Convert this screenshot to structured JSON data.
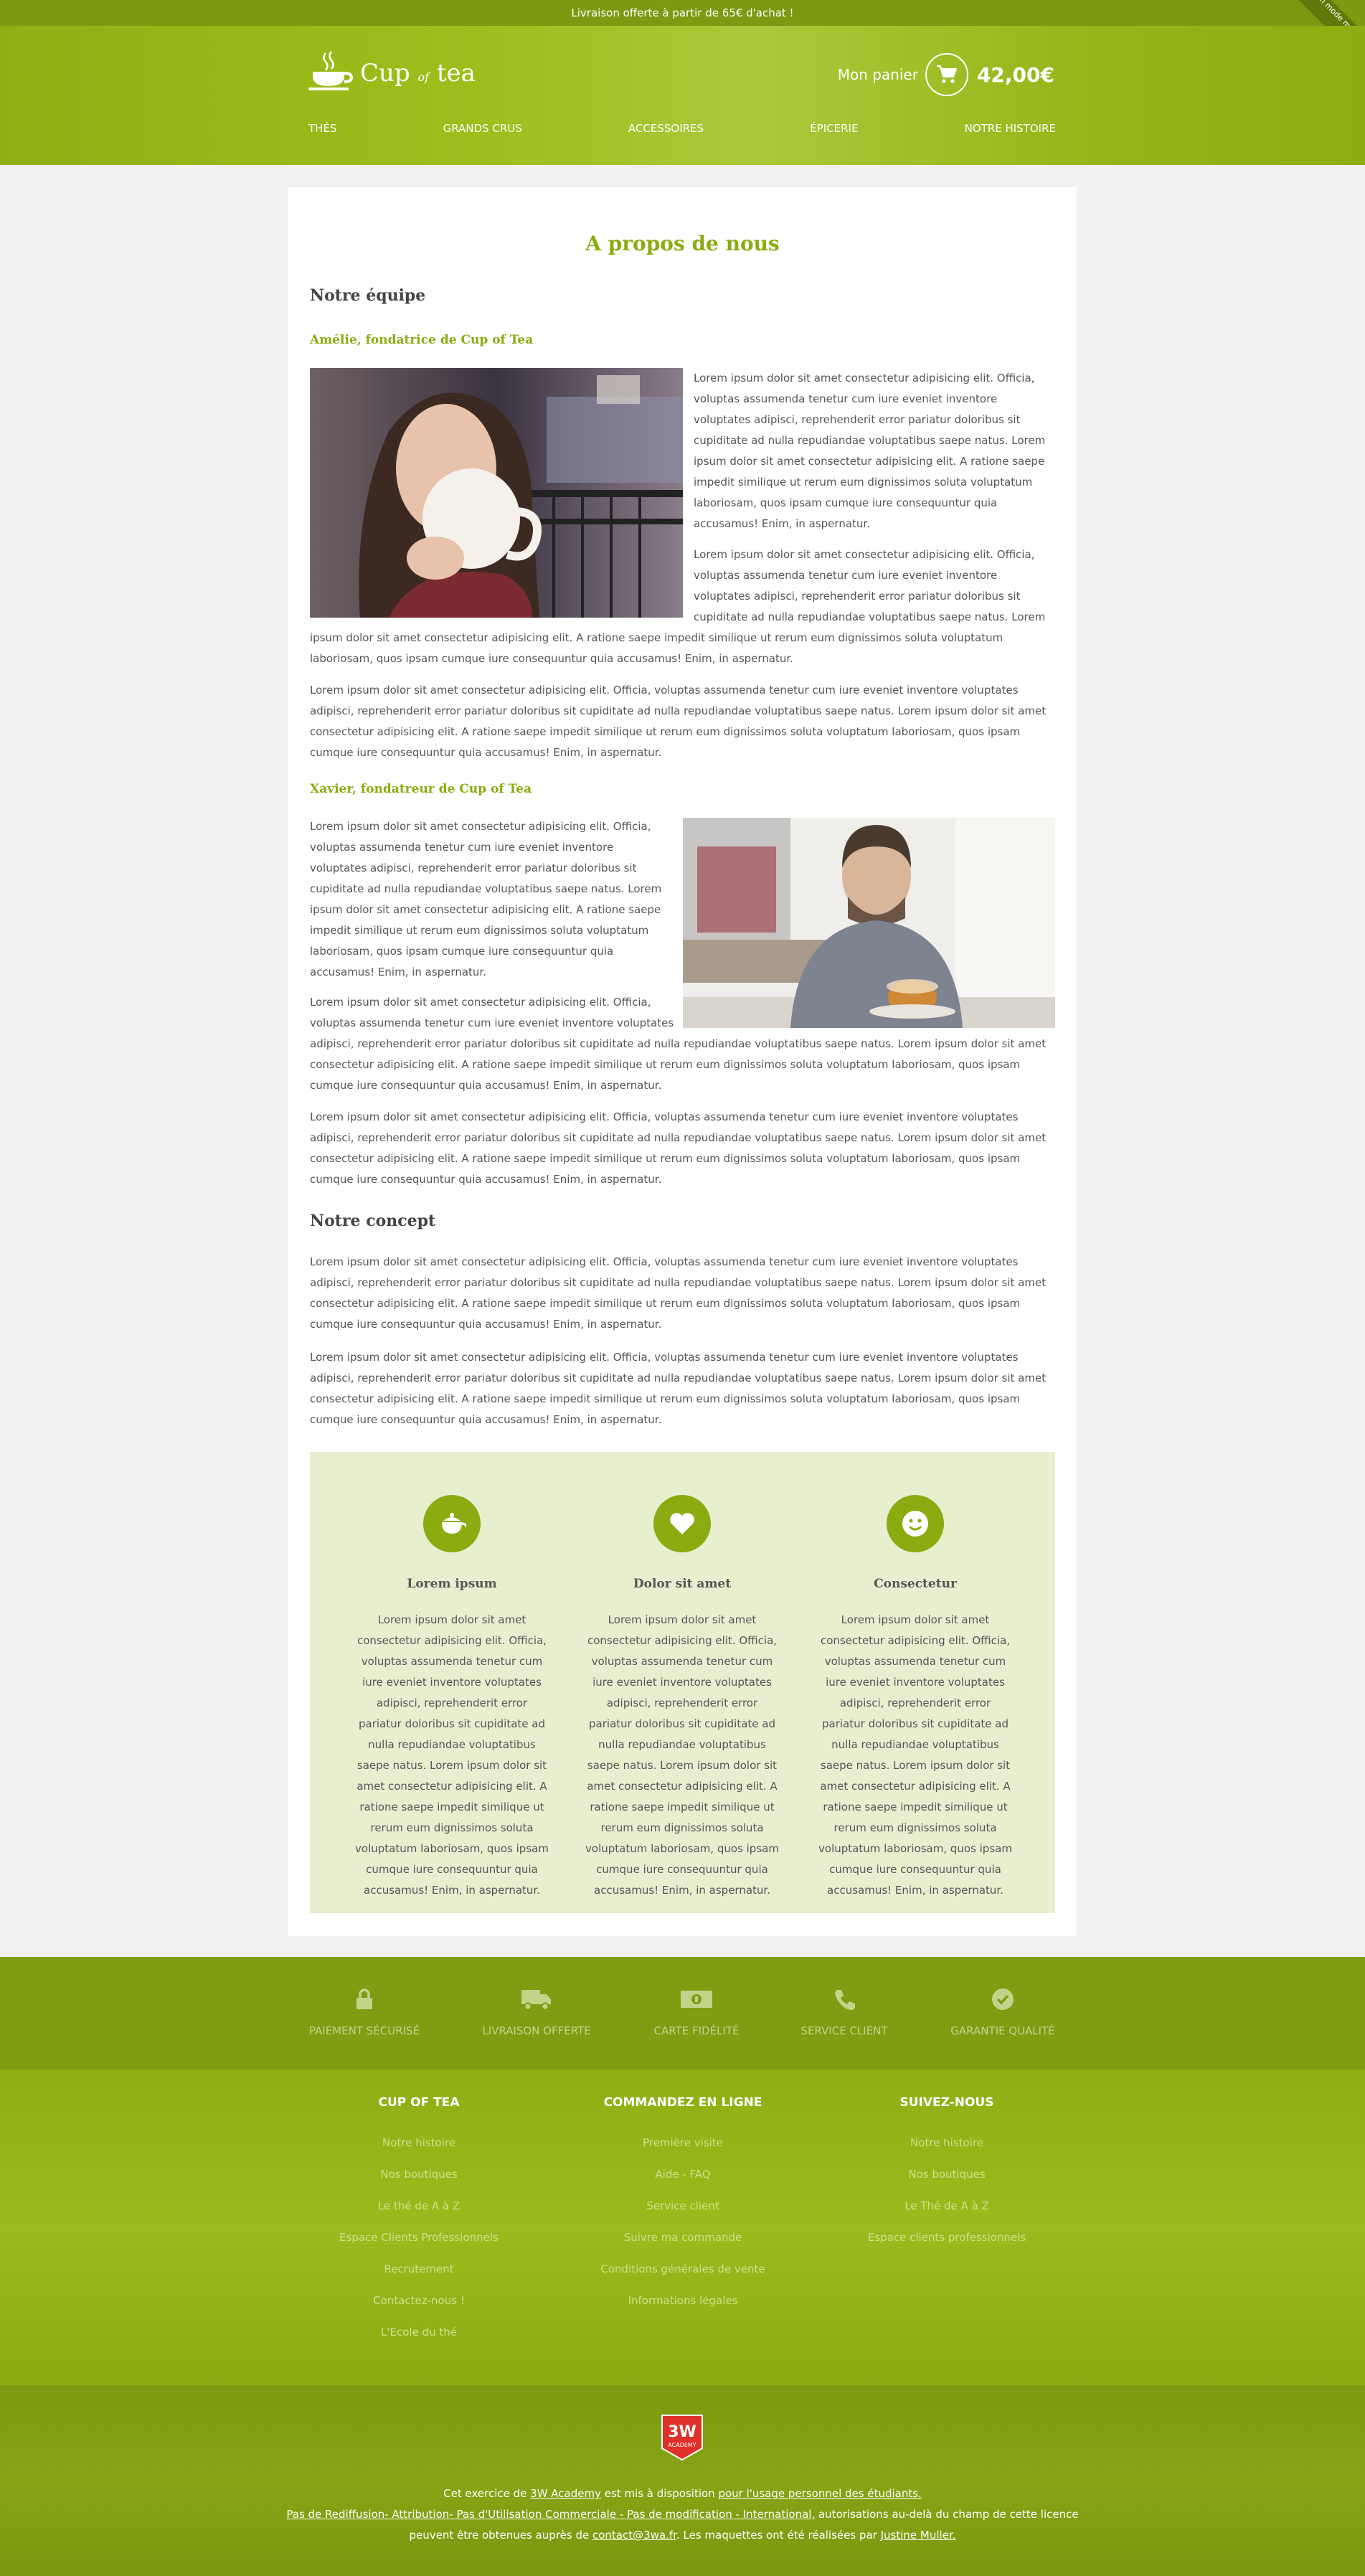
{
  "topbar": {
    "text": "Livraison offerte à partir de 65€ d'achat !",
    "ribbon": "En mode mobile"
  },
  "header": {
    "logo_main": "Cup",
    "logo_of": "of",
    "logo_tea": "tea",
    "cart_label": "Mon panier",
    "cart_total": "42,00€"
  },
  "nav": [
    "THÉS",
    "GRANDS CRUS",
    "ACCESSOIRES",
    "ÉPICERIE",
    "NOTRE HISTOIRE"
  ],
  "page": {
    "title": "A propos de nous",
    "team_heading": "Notre équipe",
    "person1": {
      "name": "Amélie, fondatrice de Cup of Tea",
      "p1": "Lorem ipsum dolor sit amet consectetur adipisicing elit. Officia, voluptas assumenda tenetur cum iure eveniet inventore voluptates adipisci, reprehenderit error pariatur doloribus sit cupiditate ad nulla repudiandae voluptatibus saepe natus. Lorem ipsum dolor sit amet consectetur adipisicing elit. A ratione saepe impedit similique ut rerum eum dignissimos soluta voluptatum laboriosam, quos ipsam cumque iure consequuntur quia accusamus! Enim, in aspernatur.",
      "p2": "Lorem ipsum dolor sit amet consectetur adipisicing elit. Officia, voluptas assumenda tenetur cum iure eveniet inventore voluptates adipisci, reprehenderit error pariatur doloribus sit cupiditate ad nulla repudiandae voluptatibus saepe natus. Lorem ipsum dolor sit amet consectetur adipisicing elit. A ratione saepe impedit similique ut rerum eum dignissimos soluta voluptatum laboriosam, quos ipsam cumque iure consequuntur quia accusamus! Enim, in aspernatur.",
      "p3": "Lorem ipsum dolor sit amet consectetur adipisicing elit. Officia, voluptas assumenda tenetur cum iure eveniet inventore voluptates adipisci, reprehenderit error pariatur doloribus sit cupiditate ad nulla repudiandae voluptatibus saepe natus. Lorem ipsum dolor sit amet consectetur adipisicing elit. A ratione saepe impedit similique ut rerum eum dignissimos soluta voluptatum laboriosam, quos ipsam cumque iure consequuntur quia accusamus! Enim, in aspernatur."
    },
    "person2": {
      "name": "Xavier, fondatreur de Cup of Tea",
      "p1": "Lorem ipsum dolor sit amet consectetur adipisicing elit. Officia, voluptas assumenda tenetur cum iure eveniet inventore voluptates adipisci, reprehenderit error pariatur doloribus sit cupiditate ad nulla repudiandae voluptatibus saepe natus. Lorem ipsum dolor sit amet consectetur adipisicing elit. A ratione saepe impedit similique ut rerum eum dignissimos soluta voluptatum laboriosam, quos ipsam cumque iure consequuntur quia accusamus! Enim, in aspernatur.",
      "p2": "Lorem ipsum dolor sit amet consectetur adipisicing elit. Officia, voluptas assumenda tenetur cum iure eveniet inventore voluptates adipisci, reprehenderit error pariatur doloribus sit cupiditate ad nulla repudiandae voluptatibus saepe natus. Lorem ipsum dolor sit amet consectetur adipisicing elit. A ratione saepe impedit similique ut rerum eum dignissimos soluta voluptatum laboriosam, quos ipsam cumque iure consequuntur quia accusamus! Enim, in aspernatur.",
      "p3": "Lorem ipsum dolor sit amet consectetur adipisicing elit. Officia, voluptas assumenda tenetur cum iure eveniet inventore voluptates adipisci, reprehenderit error pariatur doloribus sit cupiditate ad nulla repudiandae voluptatibus saepe natus. Lorem ipsum dolor sit amet consectetur adipisicing elit. A ratione saepe impedit similique ut rerum eum dignissimos soluta voluptatum laboriosam, quos ipsam cumque iure consequuntur quia accusamus! Enim, in aspernatur."
    },
    "concept_heading": "Notre concept",
    "concept_p1": "Lorem ipsum dolor sit amet consectetur adipisicing elit. Officia, voluptas assumenda tenetur cum iure eveniet inventore voluptates adipisci, reprehenderit error pariatur doloribus sit cupiditate ad nulla repudiandae voluptatibus saepe natus. Lorem ipsum dolor sit amet consectetur adipisicing elit. A ratione saepe impedit similique ut rerum eum dignissimos soluta voluptatum laboriosam, quos ipsam cumque iure consequuntur quia accusamus! Enim, in aspernatur.",
    "concept_p2": "Lorem ipsum dolor sit amet consectetur adipisicing elit. Officia, voluptas assumenda tenetur cum iure eveniet inventore voluptates adipisci, reprehenderit error pariatur doloribus sit cupiditate ad nulla repudiandae voluptatibus saepe natus. Lorem ipsum dolor sit amet consectetur adipisicing elit. A ratione saepe impedit similique ut rerum eum dignissimos soluta voluptatum laboriosam, quos ipsam cumque iure consequuntur quia accusamus! Enim, in aspernatur."
  },
  "features": [
    {
      "icon": "teapot-icon",
      "title": "Lorem ipsum",
      "text": "Lorem ipsum dolor sit amet consectetur adipisicing elit. Officia, voluptas assumenda tenetur cum iure eveniet inventore voluptates adipisci, reprehenderit error pariatur doloribus sit cupiditate ad nulla repudiandae voluptatibus saepe natus. Lorem ipsum dolor sit amet consectetur adipisicing elit. A ratione saepe impedit similique ut rerum eum dignissimos soluta voluptatum laboriosam, quos ipsam cumque iure consequuntur quia accusamus! Enim, in aspernatur."
    },
    {
      "icon": "heart-icon",
      "title": "Dolor sit amet",
      "text": "Lorem ipsum dolor sit amet consectetur adipisicing elit. Officia, voluptas assumenda tenetur cum iure eveniet inventore voluptates adipisci, reprehenderit error pariatur doloribus sit cupiditate ad nulla repudiandae voluptatibus saepe natus. Lorem ipsum dolor sit amet consectetur adipisicing elit. A ratione saepe impedit similique ut rerum eum dignissimos soluta voluptatum laboriosam, quos ipsam cumque iure consequuntur quia accusamus! Enim, in aspernatur."
    },
    {
      "icon": "smile-icon",
      "title": "Consectetur",
      "text": "Lorem ipsum dolor sit amet consectetur adipisicing elit. Officia, voluptas assumenda tenetur cum iure eveniet inventore voluptates adipisci, reprehenderit error pariatur doloribus sit cupiditate ad nulla repudiandae voluptatibus saepe natus. Lorem ipsum dolor sit amet consectetur adipisicing elit. A ratione saepe impedit similique ut rerum eum dignissimos soluta voluptatum laboriosam, quos ipsam cumque iure consequuntur quia accusamus! Enim, in aspernatur."
    }
  ],
  "services": [
    {
      "icon": "lock-icon",
      "label": "PAIEMENT SÉCURISÉ"
    },
    {
      "icon": "truck-icon",
      "label": "LIVRAISON OFFERTE"
    },
    {
      "icon": "card-icon",
      "label": "CARTE FIDÉLITÉ"
    },
    {
      "icon": "phone-icon",
      "label": "SERVICE CLIENT"
    },
    {
      "icon": "check-icon",
      "label": "GARANTIE QUALITÉ"
    }
  ],
  "footer_cols": [
    {
      "title": "CUP OF TEA",
      "links": [
        "Notre histoire",
        "Nos boutiques",
        "Le thé de A à Z",
        "Espace Clients Professionnels",
        "Recrutement",
        "Contactez-nous !",
        "L'Ecole du thé"
      ]
    },
    {
      "title": "COMMANDEZ EN LIGNE",
      "links": [
        "Première visite",
        "Aide - FAQ",
        "Service client",
        "Suivre ma commande",
        "Conditions générales de vente",
        "Informations légales"
      ]
    },
    {
      "title": "SUIVEZ-NOUS",
      "links": [
        "Notre histoire",
        "Nos boutiques",
        "Le Thé de A à Z",
        "Espace clients professionnels"
      ]
    }
  ],
  "badge": {
    "line1": "3W",
    "line2": "ACADEMY"
  },
  "credit": {
    "t1": "Cet exercice de ",
    "l1": "3W Academy",
    "t2": " est mis à disposition ",
    "l2": "pour l'usage personnel des étudiants.",
    "l3": "Pas de Rediffusion- Attribution- Pas d'Utilisation Commerciale - Pas de modification - International,",
    "t3": " autorisations au-delà du champ de cette licence",
    "t4": "peuvent être obtenues auprès de ",
    "l4": "contact@3wa.fr",
    "t5": ". Les maquettes ont été réalisées par ",
    "l5": "Justine Muller."
  }
}
